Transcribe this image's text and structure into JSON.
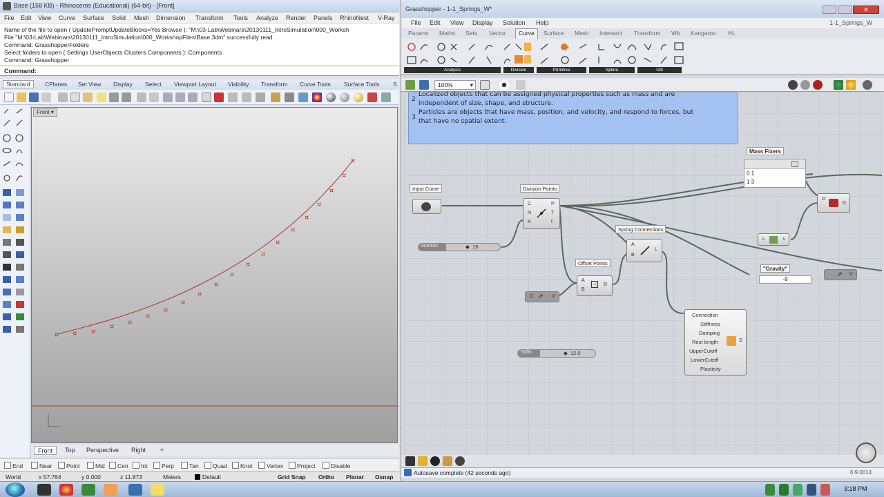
{
  "rhino": {
    "title": "Base (158 KB) - Rhinoceros (Educational) (64-bit) - [Front]",
    "menu": [
      "File",
      "Edit",
      "View",
      "Curve",
      "Surface",
      "Solid",
      "Mesh",
      "Dimension",
      "Transform",
      "Tools",
      "Analyze",
      "Render",
      "Panels",
      "RhinoNest",
      "V-Ray"
    ],
    "cmd_lines": [
      "Name of the file to open ( UpdatePromptUpdateBlocks=Yes  Browse ): \"M:\\03-Lab\\Webinars\\20130111_IntroSimulation\\000_Worksh",
      "File \"M:\\03-Lab\\Webinars\\20130111_IntroSimulation\\000_WorkshopFiles\\Base.3dm\" successfully read",
      "Command: GrasshopperFolders",
      "Select folders to open ( Settings  UserObjects  Clusters  Components ): Components",
      "Command: Grasshopper"
    ],
    "prompt": "Command:",
    "toolbar_tabs": [
      "Standard",
      "CPlanes",
      "Set View",
      "Display",
      "Select",
      "Viewport Layout",
      "Visibility",
      "Transform",
      "Curve Tools",
      "Surface Tools",
      "S"
    ],
    "viewport_label": "Front",
    "viewport_tabs": [
      "Front",
      "Top",
      "Perspective",
      "Right",
      "+"
    ],
    "osnaps": [
      "End",
      "Near",
      "Point",
      "Mid",
      "Cen",
      "Int",
      "Perp",
      "Tan",
      "Quad",
      "Knot",
      "Vertex",
      "Project",
      "Disable"
    ],
    "status": {
      "cplane": "World",
      "x": "x 57.764",
      "y": "y 0.000",
      "z": "z 11.873",
      "units": "Meters",
      "layer": "Default",
      "buttons": [
        "Grid Snap",
        "Ortho",
        "Planar",
        "Osnap"
      ]
    }
  },
  "gh": {
    "title": "Grasshopper - 1-1_Springs_W*",
    "doc_name": "1-1_Springs_W",
    "menu": [
      "File",
      "Edit",
      "View",
      "Display",
      "Solution",
      "Help"
    ],
    "component_tabs": [
      "Params",
      "Maths",
      "Sets",
      "Vector",
      "Curve",
      "Surface",
      "Mesh",
      "Intersect",
      "Transform",
      "Wb",
      "Kangaroo",
      "HL"
    ],
    "active_tab": "Curve",
    "ribbon_groups": [
      "Analysis",
      "Division",
      "Primitive",
      "Spline",
      "Util"
    ],
    "zoom": "100%",
    "note_lines": [
      "Localized objects that can be assigned physical properties such as mass and are",
      "independent of size, shape, and structure.",
      "Particles are objects that have mass, position, and velocity, and respond to forces, but",
      "that have no spatial extent."
    ],
    "note_numbers": [
      "2",
      "3"
    ],
    "components": {
      "input_curve": "Input Curve",
      "division_points": "Division Points",
      "division_inputs": [
        "C",
        "N",
        "K"
      ],
      "division_outputs": [
        "P",
        "T",
        "t"
      ],
      "number_slider": {
        "name": "numDiv",
        "value": "19"
      },
      "spring_connections": "Spring Connections",
      "spring_inputs": [
        "A",
        "B"
      ],
      "spring_output": "L",
      "offset_points": "Offset Points",
      "offset_inputs": [
        "A",
        "B"
      ],
      "offset_output": "R",
      "mass_fixers": "Mass Fixers",
      "mass_items": [
        "0 1",
        "1 3"
      ],
      "gravity_label": "\"Gravity\"",
      "gravity_value": "-9",
      "springs_inputs": [
        "Connection",
        "Stiffness",
        "Damping",
        "Rest length",
        "UpperCutoff",
        "LowerCutoff",
        "Plasticity"
      ],
      "springs_output": "S",
      "stiffness_slider": {
        "name": "Stiffn",
        "value": "12.0"
      },
      "vec_label": "V",
      "list_label": "L",
      "d_label": "D"
    },
    "status": "Autosave complete (42 seconds ago)",
    "version": "0.9.0014"
  },
  "taskbar": {
    "time": "3:18 PM"
  }
}
